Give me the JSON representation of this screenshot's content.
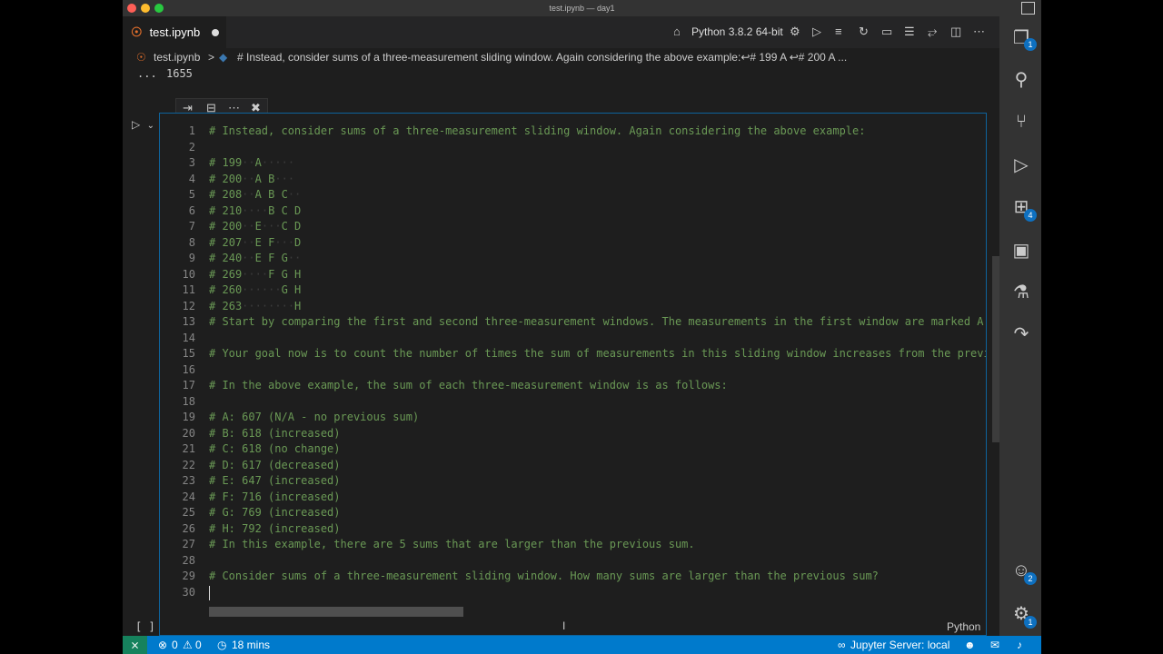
{
  "window": {
    "title": "test.ipynb — day1"
  },
  "tab": {
    "name": "test.ipynb"
  },
  "toolbar": {
    "kernel": "Python 3.8.2 64-bit"
  },
  "breadcrumb": {
    "file": "test.ipynb",
    "separator": ">",
    "cell": "# Instead, consider sums of a three-measurement sliding window. Again considering the above example:↩︎# 199  A     ↩︎# 200  A ..."
  },
  "previous_output": {
    "ellipsis": "...",
    "value": "1655"
  },
  "editor": {
    "lines": [
      {
        "n": "1",
        "text": "# Instead, consider sums of a three-measurement sliding window. Again considering the above example:"
      },
      {
        "n": "2",
        "text": ""
      },
      {
        "n": "3",
        "text": "# 199··A·····"
      },
      {
        "n": "4",
        "text": "# 200··A B···"
      },
      {
        "n": "5",
        "text": "# 208··A B C··"
      },
      {
        "n": "6",
        "text": "# 210····B C D"
      },
      {
        "n": "7",
        "text": "# 200··E···C D"
      },
      {
        "n": "8",
        "text": "# 207··E F···D"
      },
      {
        "n": "9",
        "text": "# 240··E F G··"
      },
      {
        "n": "10",
        "text": "# 269····F G H"
      },
      {
        "n": "11",
        "text": "# 260······G H"
      },
      {
        "n": "12",
        "text": "# 263········H"
      },
      {
        "n": "13",
        "text": "# Start by comparing the first and second three-measurement windows. The measurements in the first window are marked A"
      },
      {
        "n": "14",
        "text": ""
      },
      {
        "n": "15",
        "text": "# Your goal now is to count the number of times the sum of measurements in this sliding window increases from the previ"
      },
      {
        "n": "16",
        "text": ""
      },
      {
        "n": "17",
        "text": "# In the above example, the sum of each three-measurement window is as follows:"
      },
      {
        "n": "18",
        "text": ""
      },
      {
        "n": "19",
        "text": "# A: 607 (N/A - no previous sum)"
      },
      {
        "n": "20",
        "text": "# B: 618 (increased)"
      },
      {
        "n": "21",
        "text": "# C: 618 (no change)"
      },
      {
        "n": "22",
        "text": "# D: 617 (decreased)"
      },
      {
        "n": "23",
        "text": "# E: 647 (increased)"
      },
      {
        "n": "24",
        "text": "# F: 716 (increased)"
      },
      {
        "n": "25",
        "text": "# G: 769 (increased)"
      },
      {
        "n": "26",
        "text": "# H: 792 (increased)"
      },
      {
        "n": "27",
        "text": "# In this example, there are 5 sums that are larger than the previous sum."
      },
      {
        "n": "28",
        "text": ""
      },
      {
        "n": "29",
        "text": "# Consider sums of a three-measurement sliding window. How many sums are larger than the previous sum?"
      },
      {
        "n": "30",
        "text": ""
      }
    ]
  },
  "cell_footer": {
    "brackets": "[ ]",
    "language": "Python"
  },
  "activity_badges": {
    "explorer": "1",
    "extensions": "4",
    "accounts": "2",
    "manage": "1"
  },
  "status": {
    "errors": "0",
    "warnings": "0",
    "time": "18 mins",
    "jupyter": "Jupyter Server: local"
  },
  "colors": {
    "accent": "#007acc",
    "comment": "#6a9955",
    "remote": "#16825d"
  }
}
